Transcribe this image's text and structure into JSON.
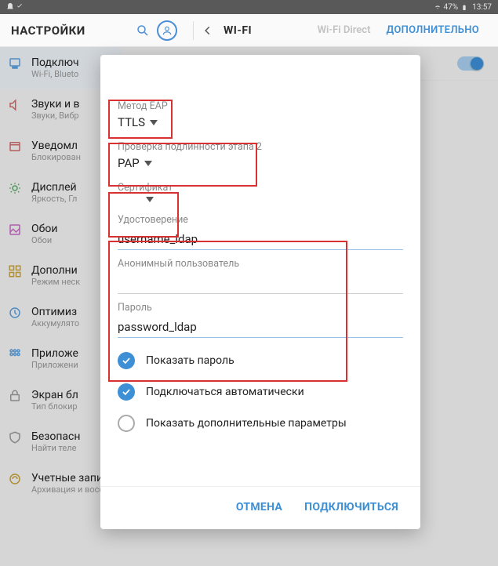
{
  "status_bar": {
    "battery_text": "47%",
    "time": "13:57"
  },
  "action_bar": {
    "settings_title": "НАСТРОЙКИ",
    "section_title": "WI-FI",
    "wifi_direct": "Wi-Fi Direct",
    "more": "ДОПОЛНИТЕЛЬНО"
  },
  "sidebar": {
    "items": [
      {
        "title": "Подключ",
        "sub": "Wi-Fi, Blueto"
      },
      {
        "title": "Звуки и в",
        "sub": "Звуки, Вибр"
      },
      {
        "title": "Уведомл",
        "sub": "Блокирован"
      },
      {
        "title": "Дисплей",
        "sub": "Яркость, Гл"
      },
      {
        "title": "Обои",
        "sub": "Обои"
      },
      {
        "title": "Дополни",
        "sub": "Режим неск"
      },
      {
        "title": "Оптимиз",
        "sub": "Аккумулято"
      },
      {
        "title": "Приложе",
        "sub": "Приложени"
      },
      {
        "title": "Экран бл",
        "sub": "Тип блокир"
      },
      {
        "title": "Безопасн",
        "sub": "Найти теле"
      },
      {
        "title": "Учетные записи",
        "sub": "Архивация и восстановление"
      }
    ]
  },
  "dialog": {
    "eap_method_label": "Метод EAP",
    "eap_method_value": "TTLS",
    "phase2_label": "Проверка подлинности этапа 2",
    "phase2_value": "PAP",
    "cert_label": "Сертификат",
    "cert_value": "",
    "identity_label": "Удостоверение",
    "identity_value": "username_ldap",
    "anon_label": "Анонимный пользователь",
    "anon_value": "",
    "password_label": "Пароль",
    "password_value": "password_ldap",
    "show_password": "Показать пароль",
    "auto_connect": "Подключаться автоматически",
    "show_advanced": "Показать дополнительные параметры",
    "cancel": "ОТМЕНА",
    "connect": "ПОДКЛЮЧИТЬСЯ"
  }
}
